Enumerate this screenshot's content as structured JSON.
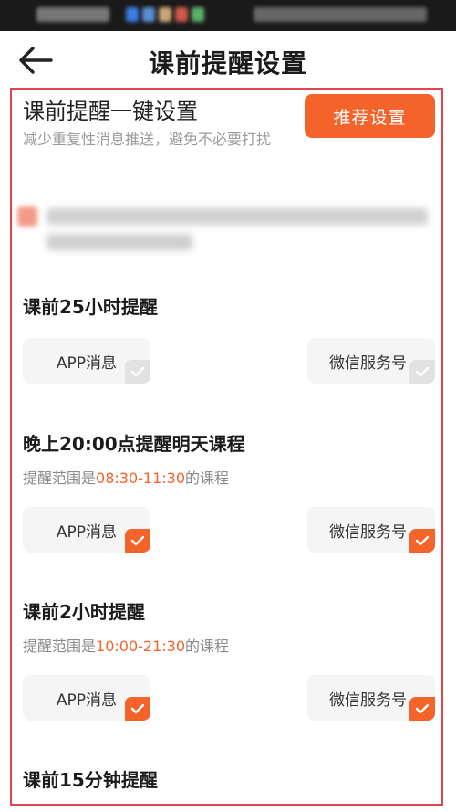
{
  "header": {
    "title": "课前提醒设置"
  },
  "one_key": {
    "title": "课前提醒一键设置",
    "description": "减少重复性消息推送，避免不必要打扰",
    "recommend_button": "推荐设置"
  },
  "sections": [
    {
      "title": "课前25小时提醒",
      "options": [
        {
          "label": "APP消息",
          "checked": false
        },
        {
          "label": "微信服务号",
          "checked": false
        }
      ]
    },
    {
      "title": "晚上20:00点提醒明天课程",
      "desc_prefix": "提醒范围是",
      "range": "08:30-11:30",
      "desc_suffix": "的课程",
      "options": [
        {
          "label": "APP消息",
          "checked": true
        },
        {
          "label": "微信服务号",
          "checked": true
        }
      ]
    },
    {
      "title": "课前2小时提醒",
      "desc_prefix": "提醒范围是",
      "range": "10:00-21:30",
      "desc_suffix": "的课程",
      "options": [
        {
          "label": "APP消息",
          "checked": true
        },
        {
          "label": "微信服务号",
          "checked": true
        }
      ]
    },
    {
      "title": "课前15分钟提醒"
    }
  ],
  "colors": {
    "accent": "#f4642a",
    "frame": "#e0474c",
    "unchecked": "#e2e2e2"
  }
}
